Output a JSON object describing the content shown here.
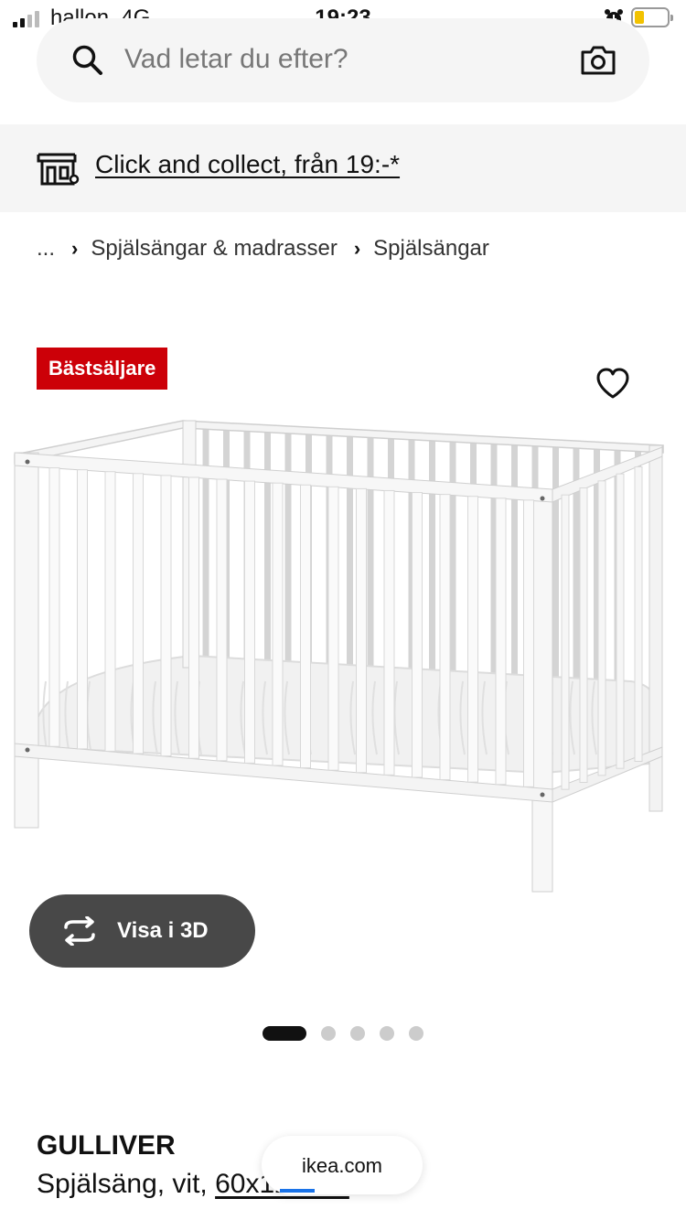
{
  "status_bar": {
    "carrier": "hallon",
    "network": "4G",
    "time": "19:23",
    "battery_level": 0.2,
    "battery_color": "#f2c200"
  },
  "search": {
    "placeholder": "Vad letar du efter?",
    "search_icon": "search-icon",
    "camera_icon": "camera-icon"
  },
  "banner": {
    "icon": "store-icon",
    "text": "Click and collect, från 19:-*"
  },
  "breadcrumb": {
    "items": [
      "...",
      "Spjälsängar & madrasser",
      "Spjälsängar"
    ]
  },
  "product_image": {
    "badge": "Bästsäljare",
    "badge_color": "#cc0008",
    "favorite_icon": "heart-icon",
    "view_3d_label": "Visa i 3D",
    "view_3d_icon": "rotate-3d-icon",
    "carousel_total": 5,
    "carousel_active": 1
  },
  "product": {
    "name": "GULLIVER",
    "desc_prefix": "Spjälsäng, vit, ",
    "desc_link": "60x120 cm"
  },
  "browser": {
    "url": "ikea.com",
    "accent": "#1a73e8"
  }
}
